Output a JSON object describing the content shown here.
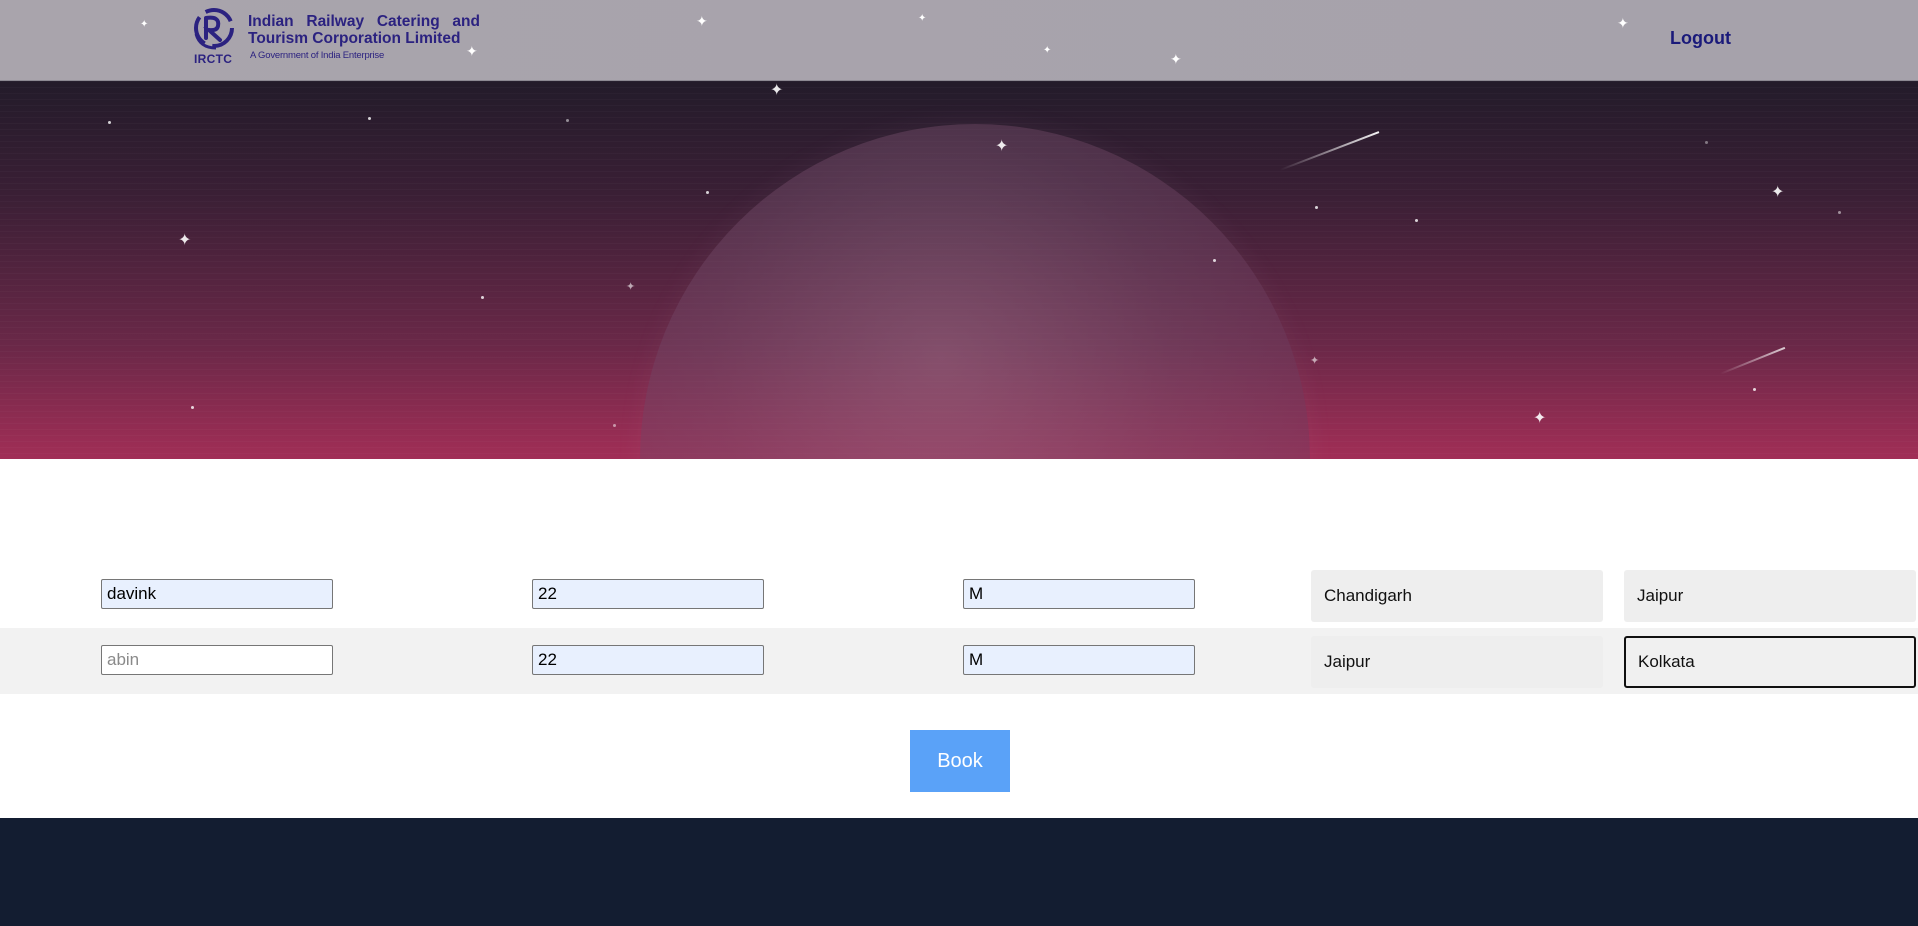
{
  "header": {
    "org_name_line1": "Indian Railway Catering and",
    "org_name_line2": "Tourism Corporation Limited",
    "org_abbr": "IRCTC",
    "tagline": "A Government of India Enterprise",
    "logout_label": "Logout",
    "logo_icon": "irctc-logo-icon"
  },
  "passengers": [
    {
      "name": "davink",
      "name_placeholder": "",
      "age": "22",
      "gender": "M",
      "from": "Chandigarh",
      "to": "Jaipur"
    },
    {
      "name": "",
      "name_placeholder": "abin",
      "age": "22",
      "gender": "M",
      "from": "Jaipur",
      "to": "Kolkata"
    }
  ],
  "actions": {
    "book_label": "Book"
  },
  "colors": {
    "header_bg": "#a9a4ac",
    "brand_text": "#2b2280",
    "hero_top": "#231b2a",
    "hero_bottom": "#a12e56",
    "book_button": "#5aa2f8",
    "footer_bg": "#131d31",
    "autofill_bg": "#e8f0fe"
  }
}
